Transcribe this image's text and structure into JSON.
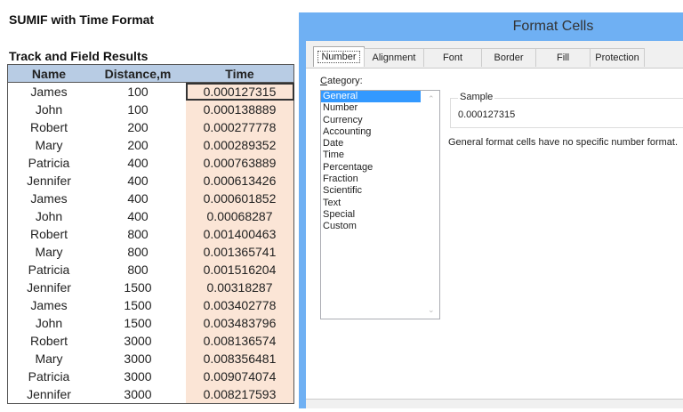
{
  "sheet": {
    "title": "SUMIF with Time Format",
    "table_title": "Track and Field Results",
    "headers": [
      "Name",
      "Distance,m",
      "Time"
    ],
    "rows": [
      [
        "James",
        "100",
        "0.000127315"
      ],
      [
        "John",
        "100",
        "0.000138889"
      ],
      [
        "Robert",
        "200",
        "0.000277778"
      ],
      [
        "Mary",
        "200",
        "0.000289352"
      ],
      [
        "Patricia",
        "400",
        "0.000763889"
      ],
      [
        "Jennifer",
        "400",
        "0.000613426"
      ],
      [
        "James",
        "400",
        "0.000601852"
      ],
      [
        "John",
        "400",
        "0.00068287"
      ],
      [
        "Robert",
        "800",
        "0.001400463"
      ],
      [
        "Mary",
        "800",
        "0.001365741"
      ],
      [
        "Patricia",
        "800",
        "0.001516204"
      ],
      [
        "Jennifer",
        "1500",
        "0.00318287"
      ],
      [
        "James",
        "1500",
        "0.003402778"
      ],
      [
        "John",
        "1500",
        "0.003483796"
      ],
      [
        "Robert",
        "3000",
        "0.008136574"
      ],
      [
        "Mary",
        "3000",
        "0.008356481"
      ],
      [
        "Patricia",
        "3000",
        "0.009074074"
      ],
      [
        "Jennifer",
        "3000",
        "0.008217593"
      ]
    ],
    "colors": {
      "header": "#b8cce4",
      "time_fill": "#fbe5d6"
    }
  },
  "dialog": {
    "title": "Format Cells",
    "tabs": [
      "Number",
      "Alignment",
      "Font",
      "Border",
      "Fill",
      "Protection"
    ],
    "active_tab": "Number",
    "category_label_first": "C",
    "category_label_rest": "ategory:",
    "categories": [
      "General",
      "Number",
      "Currency",
      "Accounting",
      "Date",
      "Time",
      "Percentage",
      "Fraction",
      "Scientific",
      "Text",
      "Special",
      "Custom"
    ],
    "selected_category": "General",
    "sample_label": "Sample",
    "sample_value": "0.000127315",
    "description": "General format cells have no specific number format.",
    "colors": {
      "frame": "#6fb0f3",
      "selection": "#3399ff"
    }
  }
}
